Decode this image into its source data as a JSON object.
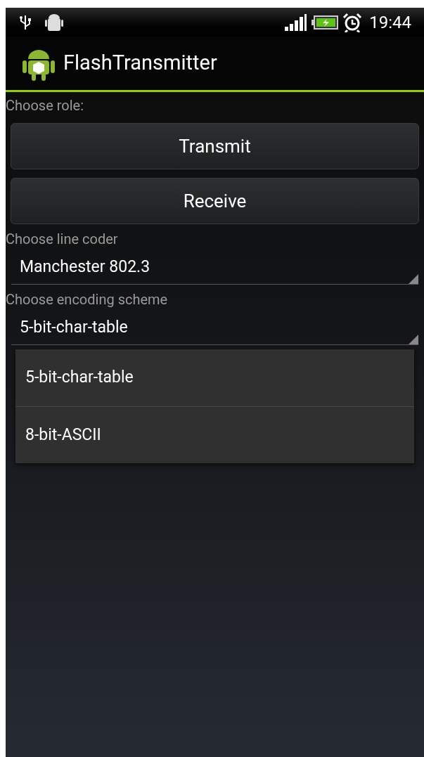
{
  "status_bar": {
    "time": "19:44"
  },
  "app_bar": {
    "title": "FlashTransmitter"
  },
  "role": {
    "label": "Choose role:",
    "buttons": [
      "Transmit",
      "Receive"
    ]
  },
  "line_coder": {
    "label": "Choose line coder",
    "value": "Manchester 802.3"
  },
  "encoding": {
    "label": "Choose encoding scheme",
    "value": "5-bit-char-table"
  },
  "dropdown": {
    "options": [
      {
        "label": "5-bit-char-table"
      },
      {
        "label": "8-bit-ASCII"
      }
    ]
  }
}
